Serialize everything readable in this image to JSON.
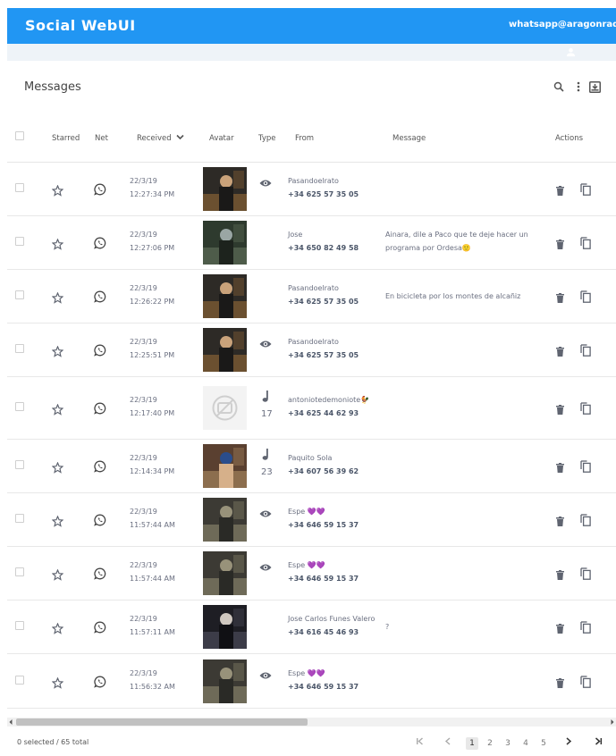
{
  "app": {
    "title": "Social WebUI",
    "account": "whatsapp@aragonradio.e"
  },
  "page": {
    "title": "Messages"
  },
  "columns": {
    "starred": "Starred",
    "net": "Net",
    "received": "Received",
    "avatar": "Avatar",
    "type": "Type",
    "from": "From",
    "message": "Message",
    "actions": "Actions"
  },
  "rows": [
    {
      "date": "22/3/19",
      "time": "12:27:34 PM",
      "type": "eye",
      "count": "",
      "name": "Pasandoelrato",
      "number": "+34 625 57 35 05",
      "message": "",
      "avatar": "man-dark"
    },
    {
      "date": "22/3/19",
      "time": "12:27:06 PM",
      "type": "",
      "count": "",
      "name": "Jose",
      "number": "+34 650 82 49 58",
      "message": "Ainara, dile a Paco que te deje hacer un programa por Ordesa🙂",
      "avatar": "forest"
    },
    {
      "date": "22/3/19",
      "time": "12:26:22 PM",
      "type": "",
      "count": "",
      "name": "Pasandoelrato",
      "number": "+34 625 57 35 05",
      "message": "En bicicleta por los montes de alcañiz",
      "avatar": "man-dark"
    },
    {
      "date": "22/3/19",
      "time": "12:25:51 PM",
      "type": "eye",
      "count": "",
      "name": "Pasandoelrato",
      "number": "+34 625 57 35 05",
      "message": "",
      "avatar": "man-dark"
    },
    {
      "date": "22/3/19",
      "time": "12:17:40 PM",
      "type": "music",
      "count": "17",
      "name": "antoniotedemoniote🐓",
      "number": "+34 625 44 62 93",
      "message": "",
      "avatar": "none"
    },
    {
      "date": "22/3/19",
      "time": "12:14:34 PM",
      "type": "music",
      "count": "23",
      "name": "Paquito Sola",
      "number": "+34 607 56 39 62",
      "message": "",
      "avatar": "couple"
    },
    {
      "date": "22/3/19",
      "time": "11:57:44 AM",
      "type": "eye",
      "count": "",
      "name": "Espe 💜💜",
      "number": "+34 646 59 15 37",
      "message": "",
      "avatar": "group"
    },
    {
      "date": "22/3/19",
      "time": "11:57:44 AM",
      "type": "eye",
      "count": "",
      "name": "Espe 💜💜",
      "number": "+34 646 59 15 37",
      "message": "",
      "avatar": "group"
    },
    {
      "date": "22/3/19",
      "time": "11:57:11 AM",
      "type": "",
      "count": "",
      "name": "Jose Carlos Funes Valero",
      "number": "+34 616 45 46 93",
      "message": "?",
      "avatar": "people"
    },
    {
      "date": "22/3/19",
      "time": "11:56:32 AM",
      "type": "eye",
      "count": "",
      "name": "Espe 💜💜",
      "number": "+34 646 59 15 37",
      "message": "",
      "avatar": "group"
    }
  ],
  "footer": {
    "selection": "0 selected / 65 total",
    "pages": [
      "1",
      "2",
      "3",
      "4",
      "5"
    ],
    "current_page": "1"
  },
  "colors": {
    "primary": "#2196f3",
    "icon": "#5f6470"
  }
}
